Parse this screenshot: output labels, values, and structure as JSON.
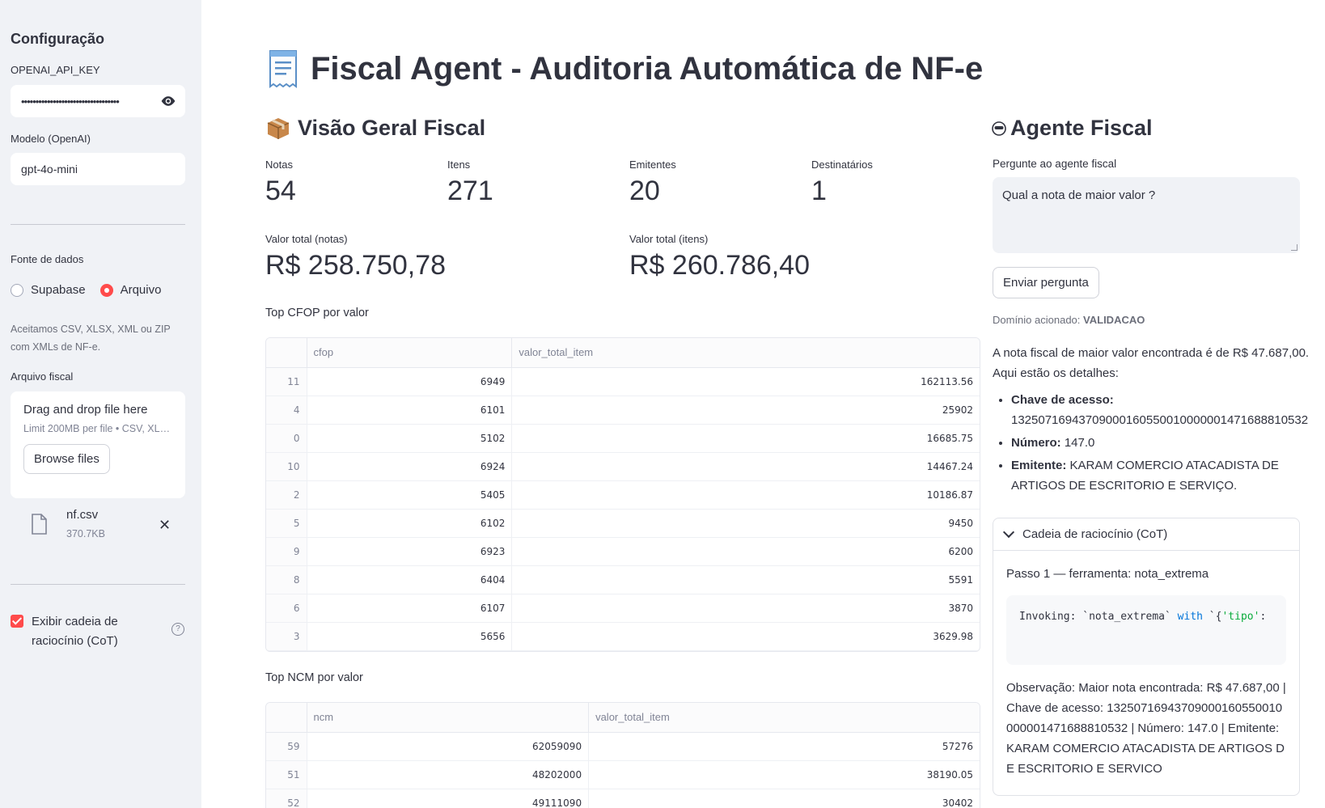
{
  "sidebar": {
    "title": "Configuração",
    "api_key_label": "OPENAI_API_KEY",
    "api_key_value": "••••••••••••••••••••••••••••••••••",
    "model_label": "Modelo (OpenAI)",
    "model_value": "gpt-4o-mini",
    "source_label": "Fonte de dados",
    "source_options": [
      "Supabase",
      "Arquivo"
    ],
    "source_selected": "Arquivo",
    "source_help": "Aceitamos CSV, XLSX, XML ou ZIP com XMLs de NF-e.",
    "file_label": "Arquivo fiscal",
    "uploader_title": "Drag and drop file here",
    "uploader_limit": "Limit 200MB per file • CSV, XL…",
    "browse_label": "Browse files",
    "file_name": "nf.csv",
    "file_size": "370.7KB",
    "cot_checkbox_label": "Exibir cadeia de raciocínio (CoT)",
    "cot_checked": true
  },
  "main": {
    "title": "Fiscal Agent - Auditoria Automática de NF-e",
    "overview_title": "Visão Geral Fiscal",
    "metrics": [
      {
        "label": "Notas",
        "value": "54"
      },
      {
        "label": "Itens",
        "value": "271"
      },
      {
        "label": "Emitentes",
        "value": "20"
      },
      {
        "label": "Destinatários",
        "value": "1"
      }
    ],
    "totals": [
      {
        "label": "Valor total (notas)",
        "value": "R$ 258.750,78"
      },
      {
        "label": "Valor total (itens)",
        "value": "R$ 260.786,40"
      }
    ],
    "cfop_caption": "Top CFOP por valor",
    "cfop_table": {
      "columns": [
        "cfop",
        "valor_total_item"
      ],
      "rows": [
        [
          "11",
          "6949",
          "162113.56"
        ],
        [
          "4",
          "6101",
          "25902"
        ],
        [
          "0",
          "5102",
          "16685.75"
        ],
        [
          "10",
          "6924",
          "14467.24"
        ],
        [
          "2",
          "5405",
          "10186.87"
        ],
        [
          "5",
          "6102",
          "9450"
        ],
        [
          "9",
          "6923",
          "6200"
        ],
        [
          "8",
          "6404",
          "5591"
        ],
        [
          "6",
          "6107",
          "3870"
        ],
        [
          "3",
          "5656",
          "3629.98"
        ]
      ]
    },
    "ncm_caption": "Top NCM por valor",
    "ncm_table": {
      "columns": [
        "ncm",
        "valor_total_item"
      ],
      "rows": [
        [
          "59",
          "62059090",
          "57276"
        ],
        [
          "51",
          "48202000",
          "38190.05"
        ],
        [
          "52",
          "49111090",
          "30402"
        ]
      ]
    }
  },
  "agent": {
    "title": "Agente Fiscal",
    "question_label": "Pergunte ao agente fiscal",
    "question_value": "Qual a nota de maior valor ?",
    "send_label": "Enviar pergunta",
    "domain_prefix": "Domínio acionado:",
    "domain_value": "VALIDACAO",
    "answer_intro": "A nota fiscal de maior valor encontrada é de R$ 47.687,00. Aqui estão os detalhes:",
    "answer_items": [
      {
        "key": "Chave de acesso:",
        "value": "13250716943709000160550010000001471688810532"
      },
      {
        "key": "Número:",
        "value": "147.0"
      },
      {
        "key": "Emitente:",
        "value": "KARAM COMERCIO ATACADISTA DE ARTIGOS DE ESCRITORIO E SERVIÇO."
      }
    ],
    "cot_title": "Cadeia de raciocínio (CoT)",
    "step_title": "Passo 1 — ferramenta: nota_extrema",
    "code_prefix": "Invoking: `nota_extrema` ",
    "code_kw": "with",
    "code_rest": " `{",
    "code_str": "'tipo'",
    "code_tail": ":",
    "observation": "Observação: Maior nota encontrada: R$ 47.687,00 | Chave de acesso: 13250716943709000160550010000001471688810532 | Número: 147.0 | Emitente: KARAM COMERCIO ATACADISTA DE ARTIGOS DE ESCRITORIO E SERVICO"
  },
  "colors": {
    "accent": "#ff4b4b",
    "sidebar_bg": "#f0f2f6",
    "text": "#31333f"
  }
}
